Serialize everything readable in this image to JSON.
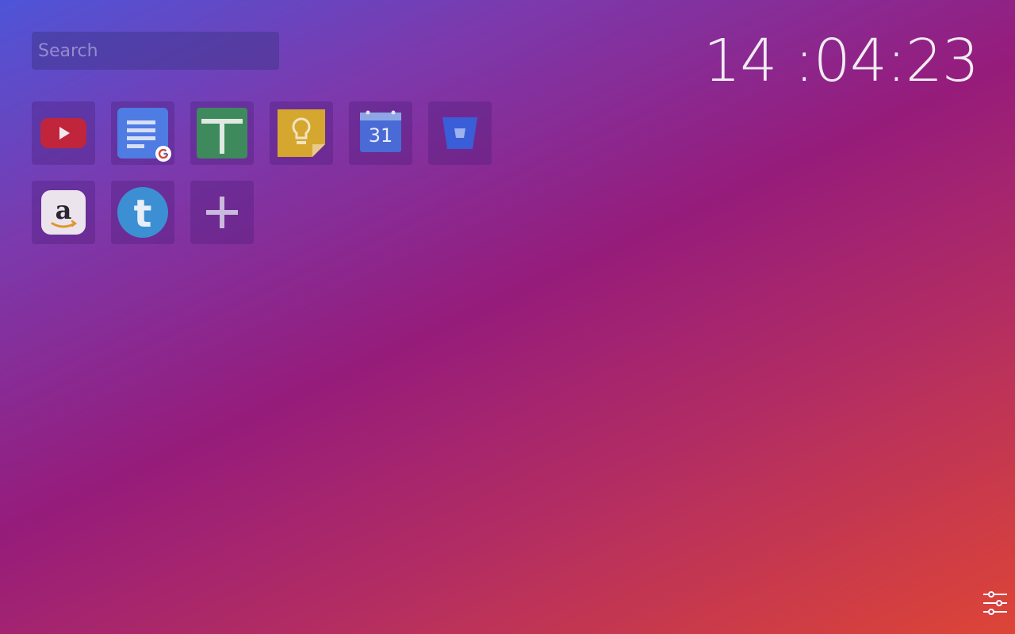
{
  "search": {
    "placeholder": "Search"
  },
  "clock": {
    "time": "14 :04:23"
  },
  "shortcuts": [
    {
      "name": "YouTube",
      "icon": "youtube-icon",
      "color": "#c1253c"
    },
    {
      "name": "Google Docs",
      "icon": "google-docs-icon",
      "color": "#4e7ce3"
    },
    {
      "name": "Google Sheets",
      "icon": "google-sheets-icon",
      "color": "#3f8a5d"
    },
    {
      "name": "Google Keep",
      "icon": "google-keep-icon",
      "color": "#d6a72e"
    },
    {
      "name": "Google Calendar",
      "icon": "google-calendar-icon",
      "color": "#4a6ad6",
      "label": "31"
    },
    {
      "name": "Bitbucket",
      "icon": "bitbucket-icon",
      "color": "#3a5dd8"
    },
    {
      "name": "Amazon",
      "icon": "amazon-icon",
      "color": "#ece4ec",
      "label": "a"
    },
    {
      "name": "Tumblr",
      "icon": "tumblr-icon",
      "color": "#3d8fd3",
      "label": "t"
    },
    {
      "name": "Add shortcut",
      "icon": "plus-icon"
    }
  ],
  "settings": {
    "icon": "sliders-icon"
  }
}
